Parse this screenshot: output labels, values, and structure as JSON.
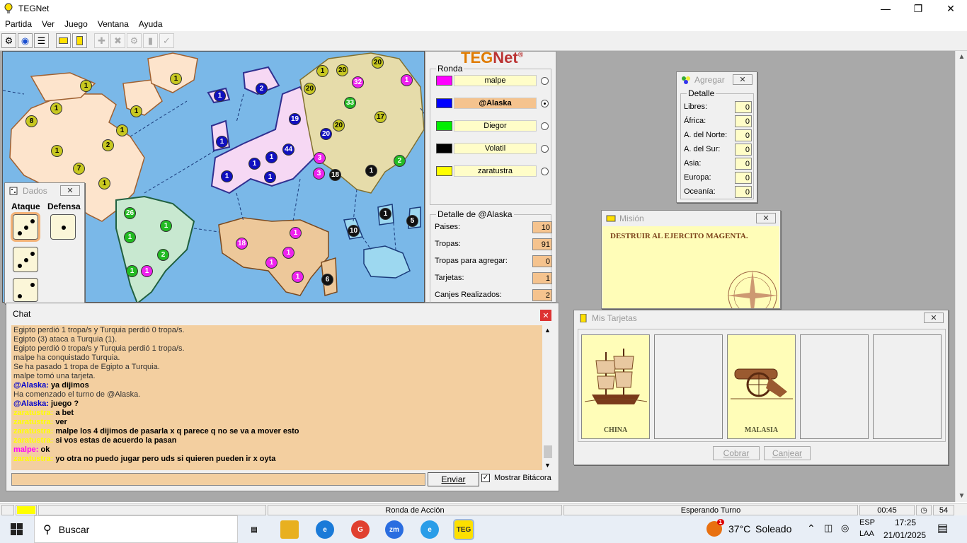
{
  "window": {
    "title": "TEGNet"
  },
  "menu": [
    "Partida",
    "Ver",
    "Juego",
    "Ventana",
    "Ayuda"
  ],
  "logo": {
    "part1": "TEG",
    "part2": "Net",
    "mark": "®"
  },
  "ronda": {
    "label": "Ronda",
    "players": [
      {
        "name": "malpe",
        "color": "#ff00ff",
        "active": false
      },
      {
        "name": "@Alaska",
        "color": "#0000ff",
        "active": true
      },
      {
        "name": "Diegor",
        "color": "#00ee00",
        "active": false
      },
      {
        "name": "Volatil",
        "color": "#000000",
        "active": false
      },
      {
        "name": "zaratustra",
        "color": "#ffff00",
        "active": false
      }
    ]
  },
  "detalle": {
    "label": "Detalle de @Alaska",
    "rows": [
      {
        "label": "Paises:",
        "value": "10"
      },
      {
        "label": "Tropas:",
        "value": "91"
      },
      {
        "label": "Tropas para agregar:",
        "value": "0"
      },
      {
        "label": "Tarjetas:",
        "value": "1"
      },
      {
        "label": "Canjes Realizados:",
        "value": "2"
      }
    ]
  },
  "agregar": {
    "title": "Agregar",
    "group": "Detalle",
    "rows": [
      {
        "label": "Libres:",
        "value": "0"
      },
      {
        "label": "África:",
        "value": "0"
      },
      {
        "label": "A. del Norte:",
        "value": "0"
      },
      {
        "label": "A. del Sur:",
        "value": "0"
      },
      {
        "label": "Asia:",
        "value": "0"
      },
      {
        "label": "Europa:",
        "value": "0"
      },
      {
        "label": "Oceanía:",
        "value": "0"
      }
    ]
  },
  "mision": {
    "title": "Misión",
    "text": "DESTRUIR AL EJERCITO MAGENTA."
  },
  "tarjetas": {
    "title": "Mis Tarjetas",
    "cards": [
      {
        "name": "CHINA",
        "type": "ship"
      },
      {
        "name": "",
        "type": "empty"
      },
      {
        "name": "MALASIA",
        "type": "cannon"
      },
      {
        "name": "",
        "type": "empty"
      },
      {
        "name": "",
        "type": "empty"
      }
    ],
    "btn_cobrar": "Cobrar",
    "btn_canjear": "Canjear"
  },
  "dados": {
    "title": "Dados",
    "attack": "Ataque",
    "defense": "Defensa"
  },
  "chat": {
    "title": "Chat",
    "send": "Enviar",
    "show_log": "Mostrar Bitácora",
    "lines": [
      {
        "kind": "sys",
        "text": "Egipto perdió 1 tropa/s y Turquia perdió 0 tropa/s."
      },
      {
        "kind": "sys",
        "text": "Egipto (3) ataca a Turquia (1)."
      },
      {
        "kind": "sys",
        "text": "Egipto perdió 0 tropa/s y Turquia perdió 1 tropa/s."
      },
      {
        "kind": "sys",
        "text": "malpe ha conquistado Turquia."
      },
      {
        "kind": "sys",
        "text": "Se ha pasado 1 tropa de Egipto a Turquia."
      },
      {
        "kind": "sys",
        "text": "malpe tomó una tarjeta."
      },
      {
        "kind": "msg",
        "nick": "@Alaska:",
        "nickColor": "#0000cc",
        "text": "ya dijimos"
      },
      {
        "kind": "sys",
        "text": "Ha comenzado el turno de @Alaska."
      },
      {
        "kind": "msg",
        "nick": "@Alaska:",
        "nickColor": "#0000cc",
        "text": "juego ?"
      },
      {
        "kind": "msg",
        "nick": "zaratustra:",
        "nickColor": "#ffff00",
        "text": "a bet"
      },
      {
        "kind": "msg",
        "nick": "zaratustra:",
        "nickColor": "#ffff00",
        "text": "ver"
      },
      {
        "kind": "msg",
        "nick": "zaratustra:",
        "nickColor": "#ffff00",
        "text": "malpe los 4 dijimos de pasarla x q parece q no se va a mover esto"
      },
      {
        "kind": "msg",
        "nick": "zaratustra:",
        "nickColor": "#ffff00",
        "text": "si vos estas de acuerdo la pasan"
      },
      {
        "kind": "msg",
        "nick": "malpe:",
        "nickColor": "#ff00ff",
        "text": "ok"
      },
      {
        "kind": "msg",
        "nick": "zaratustra:",
        "nickColor": "#ffff00",
        "text": "yo otra no puedo jugar pero uds si quieren pueden ir x oyta"
      }
    ]
  },
  "status": {
    "phase": "Ronda de Acción",
    "state": "Esperando Turno",
    "time": "00:45",
    "count": "54"
  },
  "taskbar": {
    "search": "Buscar",
    "weather_temp": "37°C",
    "weather_text": "Soleado",
    "lang1": "ESP",
    "lang2": "LAA",
    "time": "17:25",
    "date": "21/01/2025",
    "notif": "1"
  },
  "map_tokens": [
    {
      "n": "1",
      "c": "#c8c820"
    },
    {
      "n": "1",
      "c": "#c8c820"
    },
    {
      "n": "8",
      "c": "#c8c820"
    },
    {
      "n": "1",
      "c": "#c8c820"
    },
    {
      "n": "1",
      "c": "#c8c820"
    },
    {
      "n": "1",
      "c": "#c8c820"
    },
    {
      "n": "2",
      "c": "#c8c820"
    },
    {
      "n": "1",
      "c": "#c8c820"
    },
    {
      "n": "7",
      "c": "#c8c820"
    },
    {
      "n": "1",
      "c": "#c8c820"
    },
    {
      "n": "1",
      "c": "#c8c820"
    },
    {
      "n": "1",
      "c": "#1010c0"
    },
    {
      "n": "2",
      "c": "#1010c0"
    },
    {
      "n": "19",
      "c": "#1010c0"
    },
    {
      "n": "1",
      "c": "#1010c0"
    },
    {
      "n": "1",
      "c": "#1010c0"
    },
    {
      "n": "44",
      "c": "#1010c0"
    },
    {
      "n": "1",
      "c": "#1010c0"
    },
    {
      "n": "1",
      "c": "#1010c0"
    },
    {
      "n": "1",
      "c": "#1010c0"
    },
    {
      "n": "1",
      "c": "#c8c820"
    },
    {
      "n": "1",
      "c": "#c8c820"
    },
    {
      "n": "20",
      "c": "#c8c820"
    },
    {
      "n": "20",
      "c": "#c8c820"
    },
    {
      "n": "20",
      "c": "#c8c820"
    },
    {
      "n": "32",
      "c": "#ee22ee"
    },
    {
      "n": "33",
      "c": "#22bb22"
    },
    {
      "n": "17",
      "c": "#c8c820"
    },
    {
      "n": "20",
      "c": "#c8c820"
    },
    {
      "n": "20",
      "c": "#1010c0"
    },
    {
      "n": "1",
      "c": "#ee22ee"
    },
    {
      "n": "3",
      "c": "#ee22ee"
    },
    {
      "n": "3",
      "c": "#ee22ee"
    },
    {
      "n": "18",
      "c": "#111111"
    },
    {
      "n": "1",
      "c": "#111111"
    },
    {
      "n": "2",
      "c": "#22bb22"
    },
    {
      "n": "26",
      "c": "#22bb22"
    },
    {
      "n": "1",
      "c": "#22bb22"
    },
    {
      "n": "1",
      "c": "#22bb22"
    },
    {
      "n": "2",
      "c": "#22bb22"
    },
    {
      "n": "1",
      "c": "#22bb22"
    },
    {
      "n": "1",
      "c": "#ee22ee"
    },
    {
      "n": "18",
      "c": "#ee22ee"
    },
    {
      "n": "1",
      "c": "#ee22ee"
    },
    {
      "n": "1",
      "c": "#ee22ee"
    },
    {
      "n": "1",
      "c": "#ee22ee"
    },
    {
      "n": "1",
      "c": "#ee22ee"
    },
    {
      "n": "6",
      "c": "#111111"
    },
    {
      "n": "10",
      "c": "#111111"
    },
    {
      "n": "1",
      "c": "#111111"
    },
    {
      "n": "5",
      "c": "#111111"
    }
  ]
}
